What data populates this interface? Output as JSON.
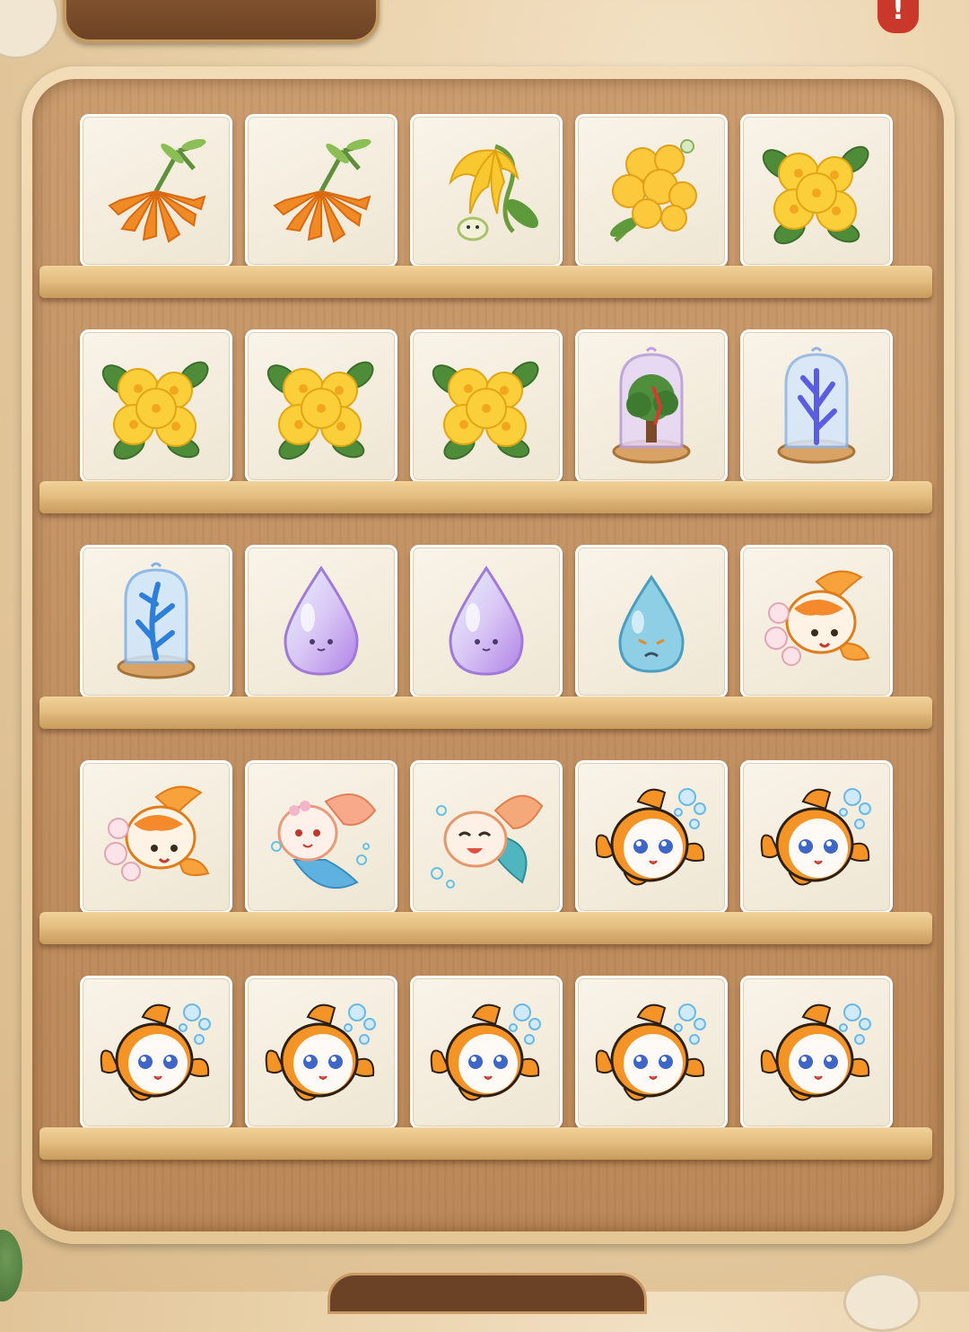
{
  "header": {
    "title": ""
  },
  "alert": {
    "label": "!"
  },
  "shelves": [
    {
      "items": [
        "orange-trumpet-flower-icon",
        "orange-trumpet-flower-icon",
        "yellow-ylang-flower-icon",
        "yellow-blossom-cluster-icon",
        "yellow-flower-cluster-icon"
      ]
    },
    {
      "items": [
        "yellow-flower-cluster-icon",
        "yellow-flower-cluster-icon",
        "yellow-flower-cluster-icon",
        "tree-in-glass-dome-icon",
        "purple-coral-in-glass-dome-icon"
      ]
    },
    {
      "items": [
        "blue-coral-in-glass-dome-icon",
        "rainbow-water-drop-icon",
        "rainbow-water-drop-icon",
        "sad-blue-water-drop-icon",
        "goldfish-with-lotus-icon"
      ]
    },
    {
      "items": [
        "goldfish-with-lotus-icon",
        "pink-betta-fish-icon",
        "happy-betta-fish-icon",
        "clownfish-icon",
        "clownfish-icon"
      ]
    },
    {
      "items": [
        "clownfish-icon",
        "clownfish-icon",
        "clownfish-icon",
        "clownfish-icon",
        "clownfish-icon"
      ]
    }
  ],
  "colors": {
    "tile_bg": "#f4eee0",
    "shelf": "#e4be80",
    "cabinet": "#c99a6c",
    "frame": "#efd7ae"
  }
}
